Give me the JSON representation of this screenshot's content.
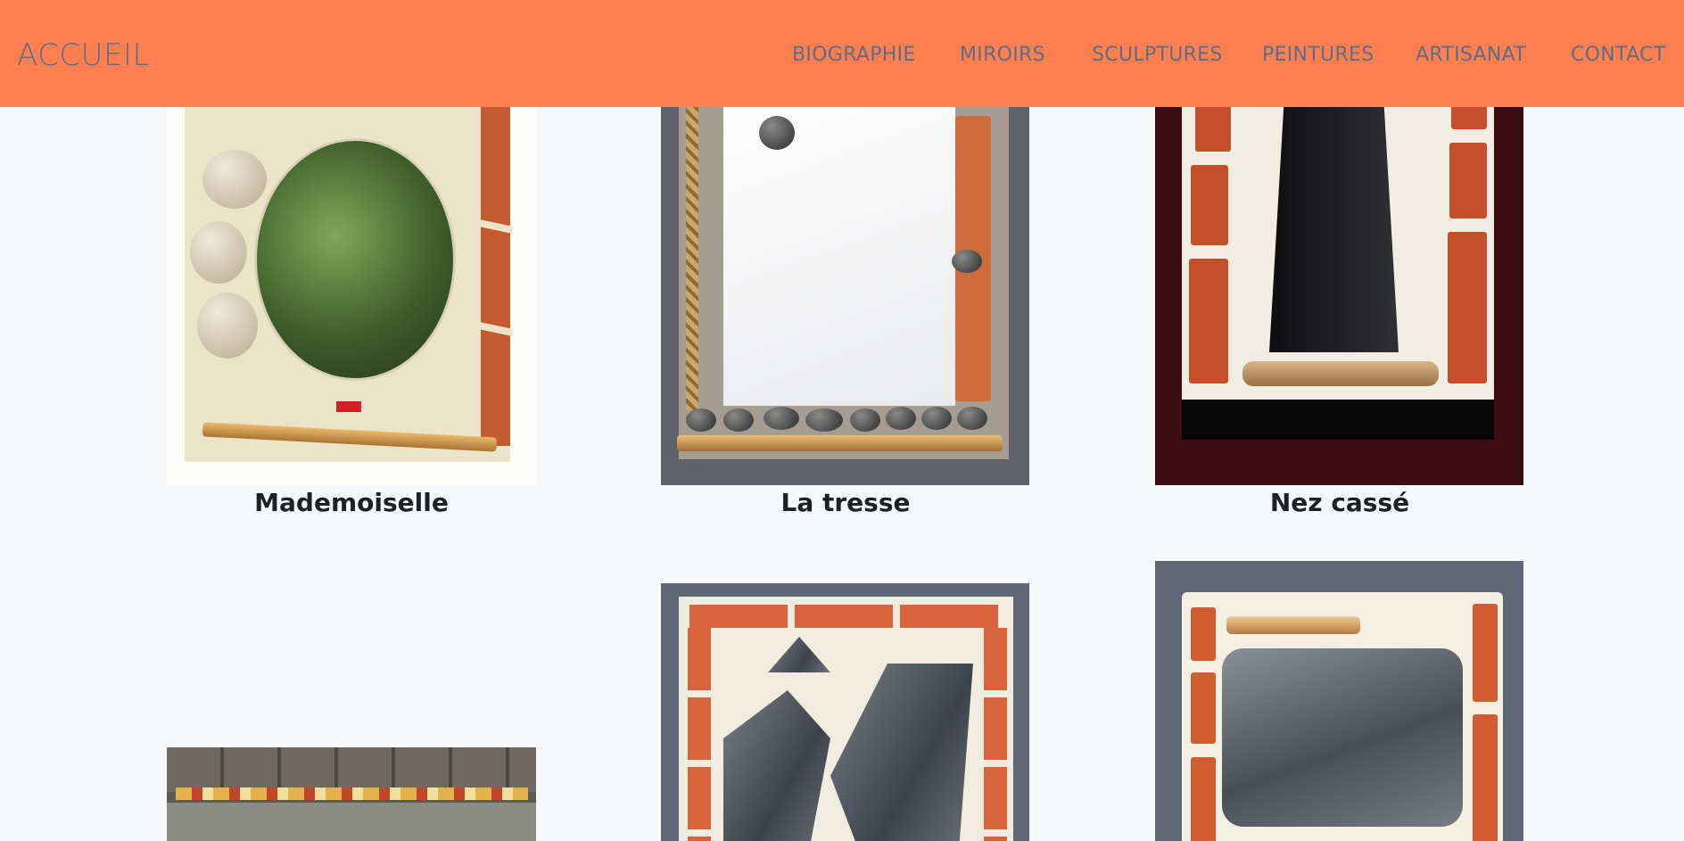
{
  "nav": {
    "brand": "ACCUEIL",
    "items": [
      "BIOGRAPHIE",
      "MIROIRS",
      "SCULPTURES",
      "PEINTURES",
      "ARTISANAT",
      "CONTACT"
    ]
  },
  "colors": {
    "navbar": "#ff7f50",
    "nav_text": "#5c6e86",
    "page_background": "#f7f8fa",
    "caption_text": "#1e2024"
  },
  "gallery": {
    "items": [
      {
        "title": "Mademoiselle"
      },
      {
        "title": "La tresse"
      },
      {
        "title": "Nez cassé"
      },
      {
        "title": ""
      },
      {
        "title": ""
      },
      {
        "title": ""
      }
    ]
  }
}
